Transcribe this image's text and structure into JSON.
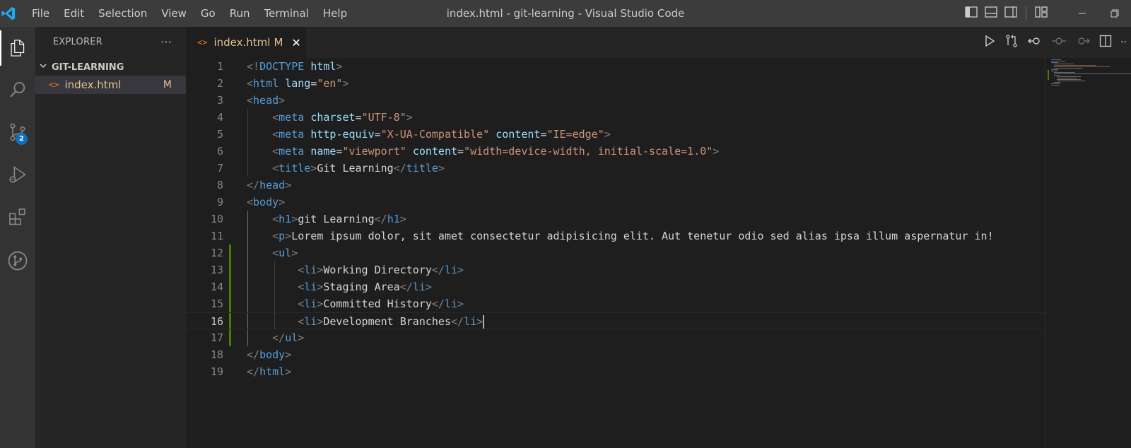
{
  "titlebar": {
    "menu": [
      "File",
      "Edit",
      "Selection",
      "View",
      "Go",
      "Run",
      "Terminal",
      "Help"
    ],
    "window_title": "index.html - git-learning - Visual Studio Code"
  },
  "activity_bar": {
    "source_control_badge": "2"
  },
  "sidebar": {
    "header": "EXPLORER",
    "more_label": "···",
    "folder_name": "GIT-LEARNING",
    "files": [
      {
        "icon": "<>",
        "name": "index.html",
        "status": "M"
      }
    ]
  },
  "tab": {
    "icon": "<>",
    "name": "index.html",
    "status": "M",
    "close": "✕"
  },
  "editor": {
    "current_line": 16,
    "modified_lines": [
      12,
      16
    ],
    "line_numbers": [
      "1",
      "2",
      "3",
      "4",
      "5",
      "6",
      "7",
      "8",
      "9",
      "10",
      "11",
      "12",
      "13",
      "14",
      "15",
      "16",
      "17",
      "18",
      "19"
    ]
  },
  "colors": {
    "background": "#1e1e1e",
    "titlebar": "#3c3c3c",
    "activity_bar": "#333333",
    "sidebar": "#252526",
    "accent_badge": "#0e70c0",
    "modified_text": "#e2c08d",
    "git_gutter": "#487e02"
  }
}
